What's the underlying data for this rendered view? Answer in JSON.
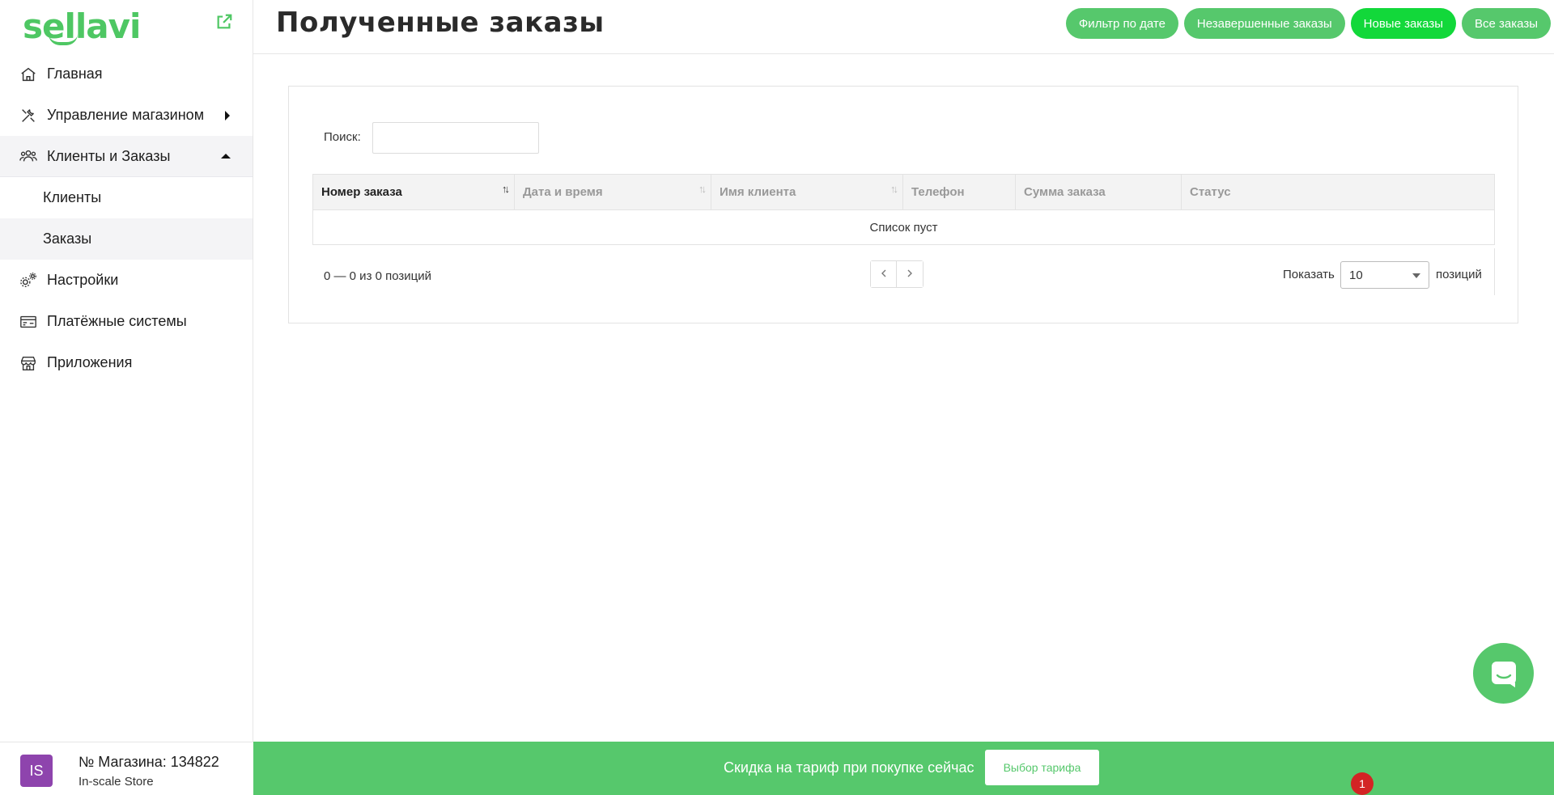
{
  "brand": {
    "logo_text": "sellavi",
    "accent": "#56c86c"
  },
  "sidebar": {
    "items": [
      {
        "label": "Главная",
        "icon": "home-icon"
      },
      {
        "label": "Управление магазином",
        "icon": "tools-icon",
        "arrow": "caret-right-icon"
      },
      {
        "label": "Клиенты и Заказы",
        "icon": "users-icon",
        "arrow": "caret-up-icon",
        "expanded": true,
        "children": [
          {
            "label": "Клиенты"
          },
          {
            "label": "Заказы",
            "active": true
          }
        ]
      },
      {
        "label": "Настройки",
        "icon": "gears-icon"
      },
      {
        "label": "Платёжные системы",
        "icon": "payment-card-icon"
      },
      {
        "label": "Приложения",
        "icon": "store-icon"
      }
    ]
  },
  "store": {
    "avatar": "IS",
    "number_text": "№ Магазина: 134822",
    "name": "In-scale Store",
    "avatar_color": "#8e44ad"
  },
  "header": {
    "title": "Полученные заказы",
    "buttons": [
      "Фильтр по дате",
      "Незавершенные заказы",
      "Новые заказы",
      "Все заказы"
    ]
  },
  "search": {
    "label": "Поиск:",
    "value": ""
  },
  "table": {
    "columns": [
      "Номер заказа",
      "Дата и время",
      "Имя клиента",
      "Телефон",
      "Сумма заказа",
      "Статус"
    ],
    "rows": [],
    "empty_text": "Список пуст"
  },
  "pagination": {
    "info": "0 — 0 из 0 позиций",
    "show_label": "Показать",
    "page_size": "10",
    "suffix": "позиций"
  },
  "promo": {
    "text": "Скидка на тариф при покупке сейчас",
    "button": "Выбор тарифа"
  },
  "notification_badge": "1"
}
